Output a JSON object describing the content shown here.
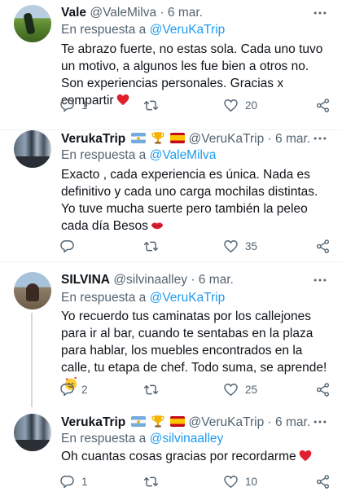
{
  "tweets": [
    {
      "display_name": "Vale",
      "handle": "@ValeMilva",
      "dot": "·",
      "date": "6 mar.",
      "reply_prefix": "En respuesta a",
      "reply_to": "@VeruKaTrip",
      "text": "Te abrazo fuerte, no estas sola. Cada uno tuvo un motivo, a algunos les fue bien a otros no. Son experiencias personales. Gracias x compartir",
      "text_emoji": "red-heart",
      "replies": "1",
      "retweets": "",
      "likes": "20"
    },
    {
      "display_name": "VerukaTrip",
      "name_emojis": [
        "argentina-flag",
        "trophy",
        "spain-flag"
      ],
      "handle": "@VeruKaTrip",
      "dot": "·",
      "date": "6 mar.",
      "reply_prefix": "En respuesta a",
      "reply_to": "@ValeMilva",
      "text": "Exacto , cada experiencia es única.  Nada es definitivo y cada uno carga mochilas distintas. Yo tuve mucha suerte pero también la peleo cada día Besos",
      "text_emoji": "kiss-lips",
      "replies": "",
      "retweets": "",
      "likes": "35"
    },
    {
      "display_name": "SILVINA",
      "handle": "@silvinaalley",
      "dot": "·",
      "date": "6 mar.",
      "reply_prefix": "En respuesta a",
      "reply_to": "@VeruKaTrip",
      "text": "Yo recuerdo tus caminatas por los callejones para ir al bar, cuando te sentabas en la plaza para hablar, los muebles encontrados en la calle, tu etapa de chef. Todo suma, se aprende!",
      "text_emoji": "smiling-face-with-hearts",
      "replies": "2",
      "retweets": "",
      "likes": "25"
    },
    {
      "display_name": "VerukaTrip",
      "name_emojis": [
        "argentina-flag",
        "trophy",
        "spain-flag"
      ],
      "handle": "@VeruKaTrip",
      "dot": "·",
      "date": "6 mar.",
      "reply_prefix": "En respuesta a",
      "reply_to": "@silvinaalley",
      "text": "Oh cuantas cosas gracias por recordarme",
      "text_emoji": "red-heart",
      "replies": "1",
      "retweets": "",
      "likes": "10"
    }
  ],
  "colors": {
    "text": "#0f1419",
    "secondary": "#536471",
    "link": "#1d9bf0",
    "divider": "#eff3f4",
    "thread_line": "#cfd9de",
    "heart": "#f91880"
  }
}
